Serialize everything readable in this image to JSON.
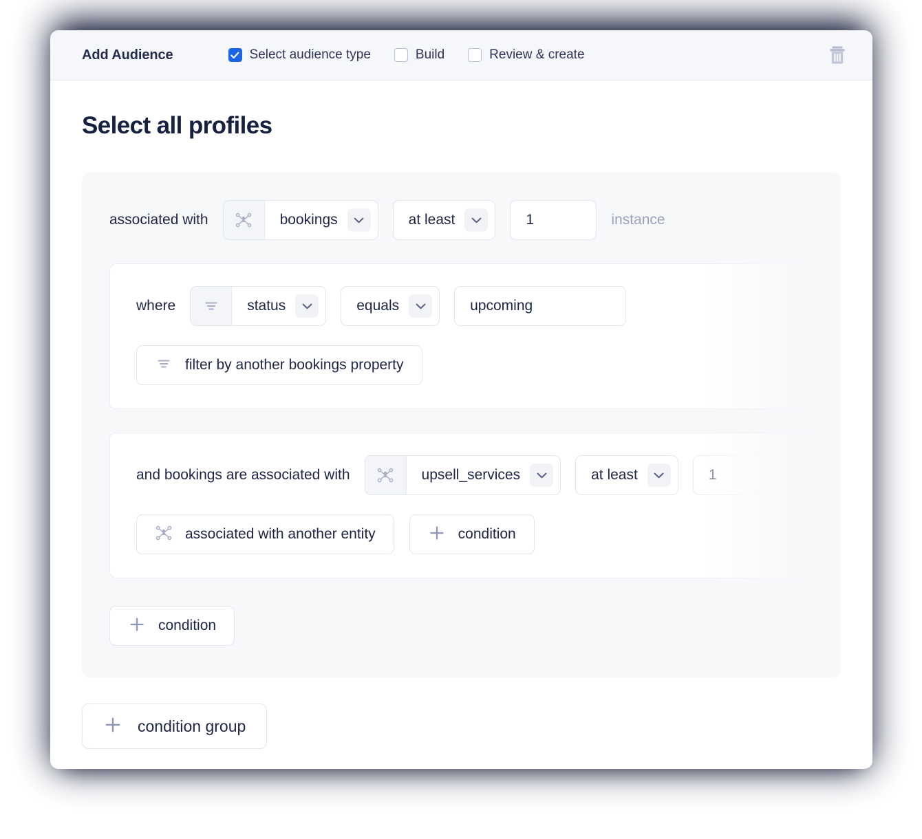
{
  "header": {
    "title": "Add Audience",
    "steps": [
      {
        "label": "Select audience type",
        "checked": true
      },
      {
        "label": "Build",
        "checked": false
      },
      {
        "label": "Review & create",
        "checked": false
      }
    ],
    "delete_icon": "trash-icon"
  },
  "page": {
    "title": "Select all profiles"
  },
  "condition_group": {
    "association_row": {
      "prefix_label": "associated with",
      "entity_icon": "entity-network-icon",
      "entity_value": "bookings",
      "entity_chevron": "chevron-down-icon",
      "operator_value": "at least",
      "operator_chevron": "chevron-down-icon",
      "count_value": "1",
      "count_suffix": "instance"
    },
    "filter_block": {
      "where_label": "where",
      "property_icon": "filter-icon",
      "property_value": "status",
      "property_chevron": "chevron-down-icon",
      "comparator_value": "equals",
      "comparator_chevron": "chevron-down-icon",
      "value_input": "upcoming",
      "add_filter_icon": "filter-icon",
      "add_filter_label": "filter by another bookings property"
    },
    "nested_block": {
      "prefix_label": "and bookings are associated with",
      "entity_icon": "entity-network-icon",
      "entity_value": "upsell_services",
      "entity_chevron": "chevron-down-icon",
      "operator_value": "at least",
      "operator_chevron": "chevron-down-icon",
      "count_value": "1",
      "add_entity_icon": "entity-network-icon",
      "add_entity_label": "associated with another entity",
      "add_condition_icon": "plus-icon",
      "add_condition_label": "condition"
    },
    "add_condition": {
      "icon": "plus-icon",
      "label": "condition"
    }
  },
  "footer": {
    "add_condition_group": {
      "icon": "plus-icon",
      "label": "condition group"
    }
  },
  "colors": {
    "accent": "#1a64e8",
    "text": "#1d2547",
    "title": "#16203f",
    "muted": "#9aa2bd",
    "panel": "#f7f8fa",
    "header_bg": "#f6f7fa",
    "border": "#e2e5ee"
  }
}
